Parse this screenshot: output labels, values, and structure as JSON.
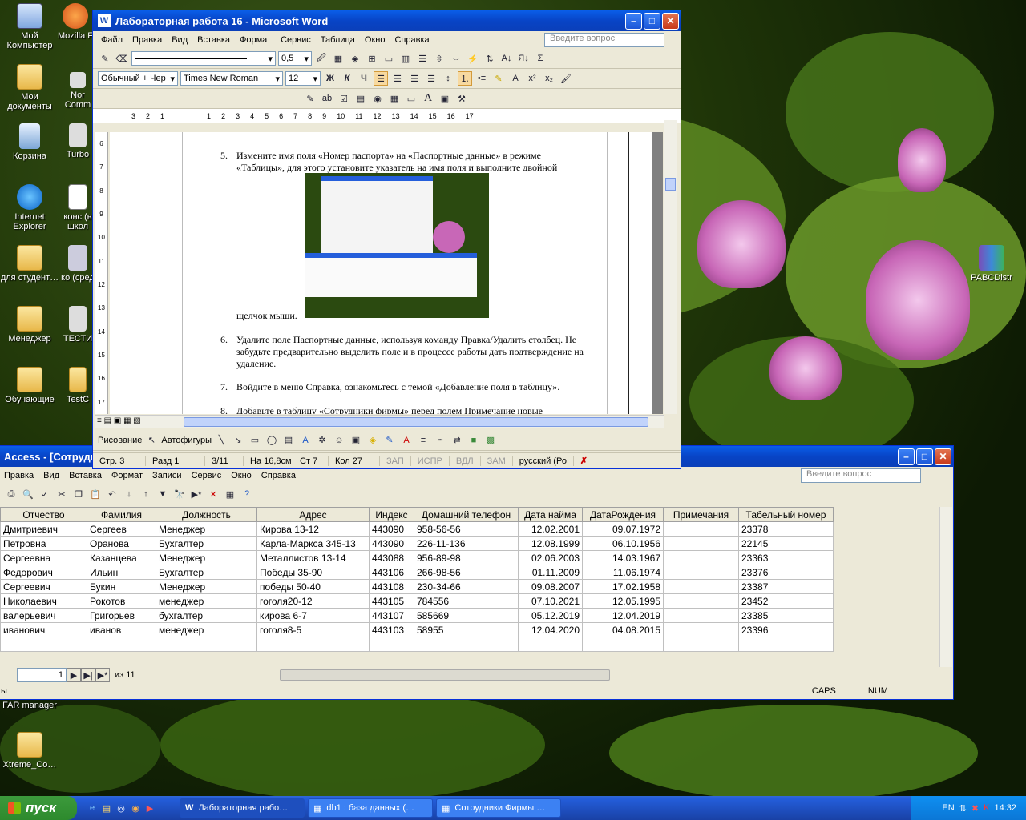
{
  "desktop": {
    "icons": [
      {
        "label": "Мой Компьютер"
      },
      {
        "label": "Mozilla F"
      },
      {
        "label": "Мои документы"
      },
      {
        "label": "Nor Comm"
      },
      {
        "label": "Корзина"
      },
      {
        "label": "Turbo"
      },
      {
        "label": "Internet Explorer"
      },
      {
        "label": "конс (в школ"
      },
      {
        "label": "для студент…"
      },
      {
        "label": "ко (сред"
      },
      {
        "label": "Менеджер"
      },
      {
        "label": "ТЕСТИ"
      },
      {
        "label": "Обучающие"
      },
      {
        "label": "TestC"
      },
      {
        "label": "FAR manager"
      },
      {
        "label": "Xtreme_Co…"
      },
      {
        "label": "PABCDistr"
      }
    ]
  },
  "word": {
    "title": "Лабораторная работа 16 - Microsoft Word",
    "menu": [
      "Файл",
      "Правка",
      "Вид",
      "Вставка",
      "Формат",
      "Сервис",
      "Таблица",
      "Окно",
      "Справка"
    ],
    "question_placeholder": "Введите вопрос",
    "line_width": "0,5",
    "style": "Обычный + Чер",
    "font": "Times New Roman",
    "size": "12",
    "ruler_numbers": [
      "3",
      "2",
      "1",
      "1",
      "2",
      "3",
      "4",
      "5",
      "6",
      "7",
      "8",
      "9",
      "10",
      "11",
      "12",
      "13",
      "14",
      "15",
      "16",
      "17"
    ],
    "vruler_numbers": [
      "6",
      "7",
      "8",
      "9",
      "10",
      "11",
      "12",
      "13",
      "14",
      "15",
      "16",
      "17"
    ],
    "items": [
      {
        "num": "5.",
        "text": "Измените имя поля «Номер паспорта» на «Паспортные данные» в режиме «Таблицы», для этого установите указатель на имя поля и выполните двойной"
      },
      {
        "num": "",
        "text": "щелчок мыши."
      },
      {
        "num": "6.",
        "text": "Удалите поле Паспортные данные, используя команду Правка/Удалить столбец. Не забудьте предварительно выделить поле и в процессе работы дать подтверждение на удаление."
      },
      {
        "num": "7.",
        "text": "Войдите в меню Справка, ознакомьтесь с темой «Добавление поля в таблицу»."
      },
      {
        "num": "8.",
        "text": "Добавьте в таблицу «Сотрудники фирмы» перед полем Примечание новые"
      }
    ],
    "drawing": {
      "draw_label": "Рисование",
      "autoshapes_label": "Автофигуры"
    },
    "status": {
      "page": "Стр. 3",
      "section": "Разд 1",
      "pages": "3/11",
      "at": "На 16,8см",
      "line": "Ст 7",
      "col": "Кол 27",
      "rec": "ЗАП",
      "trk": "ИСПР",
      "ext": "ВДЛ",
      "ovr": "ЗАМ",
      "lang": "русский (Ро"
    }
  },
  "access": {
    "title": "Access - [Сотрудн",
    "menu": [
      "Правка",
      "Вид",
      "Вставка",
      "Формат",
      "Записи",
      "Сервис",
      "Окно",
      "Справка"
    ],
    "question_placeholder": "Введите вопрос",
    "columns": [
      "Отчество",
      "Фамилия",
      "Должность",
      "Адрес",
      "Индекс",
      "Домашний телефон",
      "Дата найма",
      "ДатаРождения",
      "Примечания",
      "Табельный номер"
    ],
    "rows": [
      [
        "Дмитриевич",
        "Сергеев",
        "Менеджер",
        "Кирова 13-12",
        "443090",
        "958-56-56",
        "12.02.2001",
        "09.07.1972",
        "",
        "23378"
      ],
      [
        "Петровна",
        "Оранова",
        "Бухгалтер",
        "Карла-Маркса 345-13",
        "443090",
        "226-11-136",
        "12.08.1999",
        "06.10.1956",
        "",
        "22145"
      ],
      [
        "Сергеевна",
        "Казанцева",
        "Менеджер",
        "Металлистов 13-14",
        "443088",
        "956-89-98",
        "02.06.2003",
        "14.03.1967",
        "",
        "23363"
      ],
      [
        "Федорович",
        "Ильин",
        "Бухгалтер",
        "Победы 35-90",
        "443106",
        "266-98-56",
        "01.11.2009",
        "11.06.1974",
        "",
        "23376"
      ],
      [
        "Сергеевич",
        "Букин",
        "Менеджер",
        "победы 50-40",
        "443108",
        "230-34-66",
        "09.08.2007",
        "17.02.1958",
        "",
        "23387"
      ],
      [
        "Николаевич",
        "Рокотов",
        "менеджер",
        "гоголя20-12",
        "443105",
        "784556",
        "07.10.2021",
        "12.05.1995",
        "",
        "23452"
      ],
      [
        "валерьевич",
        "Григорьев",
        "бухгалтер",
        "кирова 6-7",
        "443107",
        "585669",
        "05.12.2019",
        "12.04.2019",
        "",
        "23385"
      ],
      [
        "иванович",
        "иванов",
        "менеджер",
        "гоголя8-5",
        "443103",
        "58955",
        "12.04.2020",
        "04.08.2015",
        "",
        "23396"
      ]
    ],
    "record_current": "1",
    "record_total": "из 11",
    "status_left": "ы",
    "caps": "CAPS",
    "num": "NUM"
  },
  "taskbar": {
    "start": "пуск",
    "tasks": [
      "Лабораторная рабо…",
      "db1 : база данных (…",
      "Сотрудники Фирмы …"
    ],
    "lang": "EN",
    "clock": "14:32"
  }
}
